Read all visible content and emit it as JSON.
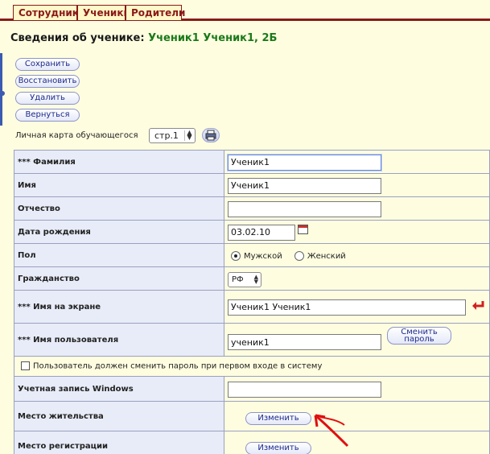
{
  "tabs": [
    "Сотрудники",
    "Ученики",
    "Родители"
  ],
  "heading": {
    "prefix": "Сведения об ученике:",
    "student": "Ученик1 Ученик1, 2Б"
  },
  "actions": {
    "save": "Сохранить",
    "restore": "Восстановить",
    "delete": "Удалить",
    "back": "Вернуться"
  },
  "card": {
    "label": "Личная карта обучающегося",
    "page": "стр.1",
    "print_icon": "printer-icon"
  },
  "form": {
    "surname_label": "*** Фамилия",
    "surname": "Ученик1",
    "name_label": "Имя",
    "name": "Ученик1",
    "patronymic_label": "Отчество",
    "patronymic": "",
    "birth_label": "Дата рождения",
    "birth": "03.02.10",
    "sex_label": "Пол",
    "sex_male": "Мужской",
    "sex_female": "Женский",
    "citizenship_label": "Гражданство",
    "citizenship": "РФ",
    "display_label": "*** Имя на экране",
    "display": "Ученик1 Ученик1",
    "username_label": "*** Имя пользователя",
    "username": "ученик1",
    "change_password_1": "Сменить",
    "change_password_2": "пароль",
    "must_change_text": "Пользователь должен сменить пароль при первом входе в систему",
    "windows_label": "Учетная запись Windows",
    "windows": "",
    "residence_label": "Место жительства",
    "registration_label": "Место регистрации",
    "change_button": "Изменить"
  },
  "colors": {
    "tab_border": "#8a1a1a",
    "student_name": "#1a7a1a",
    "annotation_arrow": "#e01010"
  }
}
